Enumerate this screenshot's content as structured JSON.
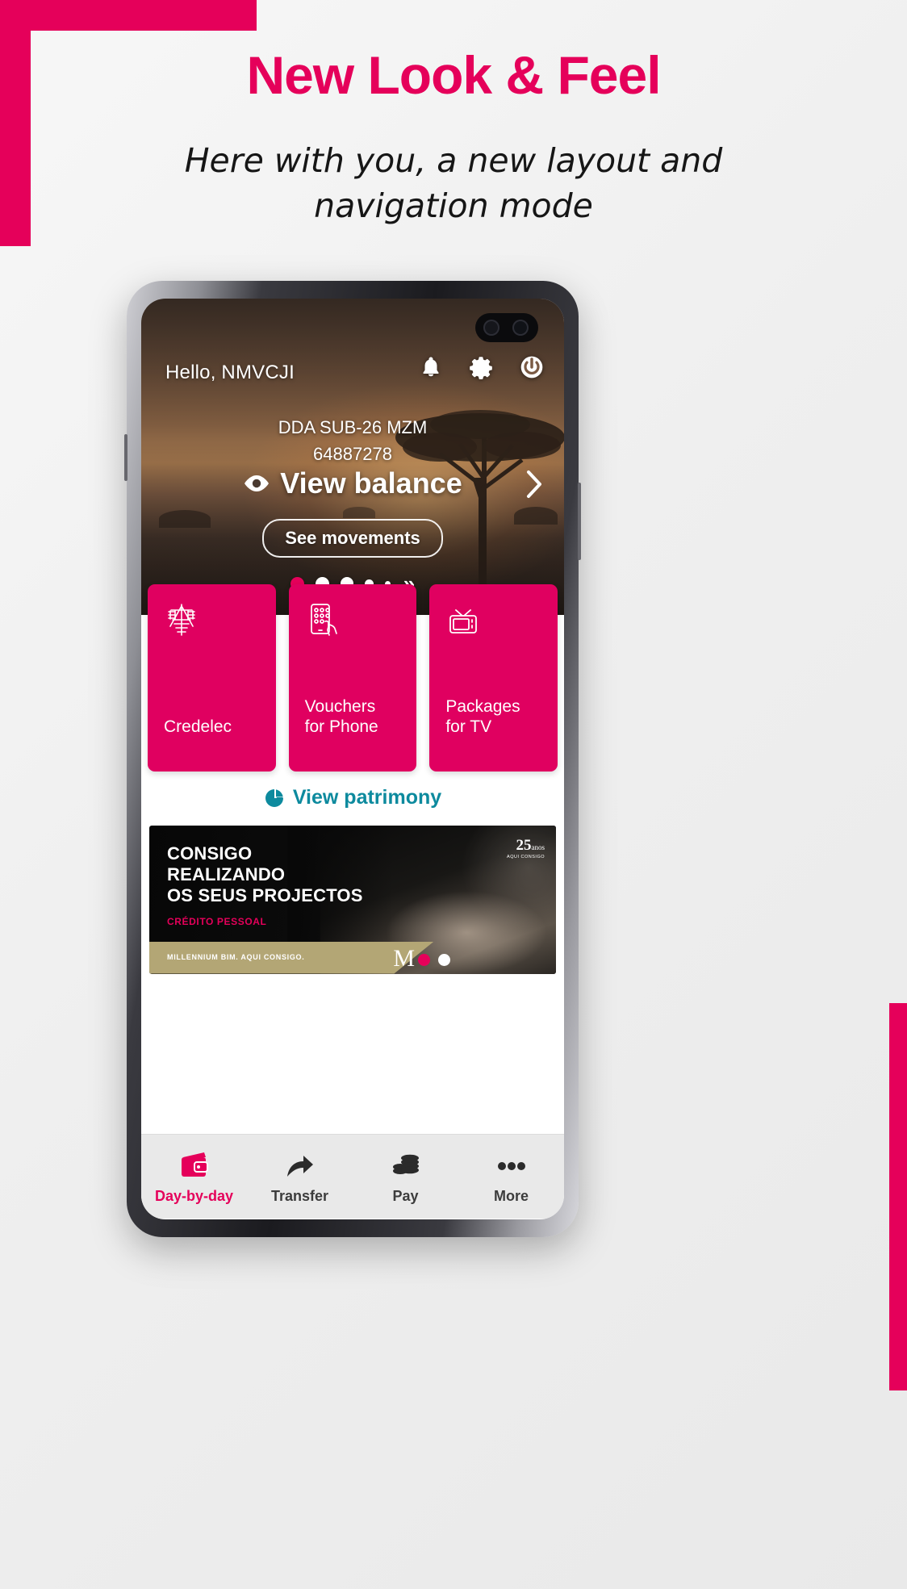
{
  "promo_page": {
    "headline": "New Look & Feel",
    "subheadline": "Here with you, a new layout and navigation mode"
  },
  "brand": {
    "accent_pink": "#e5005a",
    "tile_pink": "#e00060",
    "teal": "#0d8a9e",
    "gold": "#b3a675"
  },
  "app": {
    "hero": {
      "greeting": "Hello, NMVCJI",
      "header_icons": [
        {
          "name": "bell-icon",
          "label": "Notifications"
        },
        {
          "name": "gear-icon",
          "label": "Settings"
        },
        {
          "name": "power-icon",
          "label": "Logout"
        }
      ],
      "account_name": "DDA SUB-26 MZM",
      "account_number": "64887278",
      "balance_action": "View balance",
      "balance_icon": "eye-icon",
      "next_icon": "chevron-right-icon",
      "movements_button": "See movements",
      "carousel": {
        "total_dots": 5,
        "active_index": 0,
        "more_icon": "double-chevron-right-icon"
      }
    },
    "tiles": [
      {
        "icon": "electricity-tower-icon",
        "label": "Credelec"
      },
      {
        "icon": "phone-topup-icon",
        "label": "Vouchers\nfor Phone"
      },
      {
        "icon": "tv-icon",
        "label": "Packages\nfor TV"
      }
    ],
    "patrimony_link": {
      "label": "View patrimony",
      "icon": "pie-chart-icon"
    },
    "promo_banner": {
      "line1": "CONSIGO",
      "line2": "REALIZANDO",
      "line3": "OS SEUS PROJECTOS",
      "kicker": "CRÉDITO PESSOAL",
      "footer_text": "MILLENNIUM BIM. AQUI CONSIGO.",
      "logo_letter": "M",
      "badge_number": "25",
      "badge_suffix": "anos",
      "badge_tagline": "AQUI CONSIGO",
      "dots": {
        "total": 2,
        "active_index": 0
      }
    },
    "bottom_nav": [
      {
        "icon": "wallet-icon",
        "label": "Day-by-day",
        "active": true
      },
      {
        "icon": "transfer-arrow-icon",
        "label": "Transfer",
        "active": false
      },
      {
        "icon": "coins-icon",
        "label": "Pay",
        "active": false
      },
      {
        "icon": "more-dots-icon",
        "label": "More",
        "active": false
      }
    ]
  }
}
